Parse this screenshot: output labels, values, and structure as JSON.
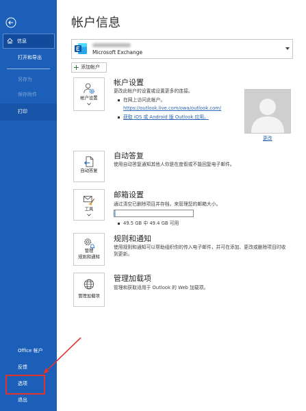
{
  "colors": {
    "sidebar": "#1c5fb8",
    "sidebar_selected": "#124a9c",
    "sidebar_selected_border": "#5b8fd3",
    "sidebar_hover": "#1854a8",
    "sidebar_disabled_text": "#7ea4d8",
    "link": "#2a63b3",
    "annotation": "#e3342b",
    "progress_fill": "#8fc3ef"
  },
  "sidebar": {
    "back_icon": "back-arrow-icon",
    "items": [
      {
        "label": "信息",
        "icon": "home-icon",
        "selected": true
      },
      {
        "label": "打开和导出"
      },
      {
        "label": "另存为",
        "disabled": true
      },
      {
        "label": "保存附件",
        "disabled": true
      },
      {
        "label": "打印",
        "hover": true
      }
    ],
    "footer_items": [
      {
        "label": "Office 帐户"
      },
      {
        "label": "反馈"
      },
      {
        "label": "选项",
        "annotated": true
      },
      {
        "label": "退出"
      }
    ]
  },
  "main": {
    "title": "帐户信息",
    "account_selector": {
      "icon": "exchange-icon",
      "account_type": "Microsoft Exchange",
      "dropdown_icon": "caret-down-icon"
    },
    "add_account": {
      "icon": "plus-icon",
      "label": "添加帐户"
    },
    "account_settings": {
      "button_icon": "account-settings-icon",
      "button_label": "帐户设置",
      "title": "帐户设置",
      "description": "更改此帐户的设置或设置更多的连接。",
      "web_access": {
        "text": "在网上访问此帐户。",
        "link": "https://outlook.live.com/owa/outlook.com/"
      },
      "mobile_app_link": "获取 iOS 或 Android 版 Outlook 应用。",
      "photo": {
        "icon": "default-avatar-icon",
        "change_label": "更改"
      }
    },
    "automatic_replies": {
      "button_icon": "automatic-replies-icon",
      "button_label": "自动答复",
      "title": "自动答复",
      "description": "使用自动答复通知其他人你是在度假或不能回复电子邮件。"
    },
    "mailbox_settings": {
      "button_icon": "mailbox-cleanup-icon",
      "button_label": "工具",
      "title": "邮箱设置",
      "description": "通过清空已删除项目并存档，来管理您的邮箱大小。",
      "storage_used_fraction": 0.02,
      "storage_text": "49.5 GB 中 49.4 GB 可用"
    },
    "rules_and_alerts": {
      "button_icon": "rules-alerts-icon",
      "button_label_lines": [
        "管理",
        "规则和通知"
      ],
      "title": "规则和通知",
      "description": "使用规则和通知可以帮助组织你的传入电子邮件，并可在添加、更改或删除项目时收到更新。"
    },
    "addins": {
      "button_icon": "globe-icon",
      "button_label": "管理加载项",
      "title": "管理加载项",
      "description": "管理和获取适用于 Outlook 的 Web 加载项。"
    }
  }
}
